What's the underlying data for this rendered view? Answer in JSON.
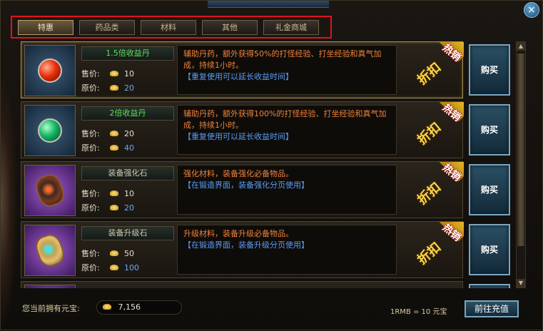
{
  "window": {
    "close_icon": "×"
  },
  "tabs": [
    {
      "label": "特惠",
      "active": true
    },
    {
      "label": "药品类",
      "active": false
    },
    {
      "label": "材料",
      "active": false
    },
    {
      "label": "其他",
      "active": false
    },
    {
      "label": "礼金商城",
      "active": false
    }
  ],
  "items": [
    {
      "name": "1.5倍收益丹",
      "name_color": "green",
      "icon": "red-orb-icon",
      "price_label": "售价:",
      "price": "10",
      "orig_label": "原价:",
      "orig_price": "20",
      "desc": "辅助丹药，额外获得50%的打怪经验、打坐经验和真气加成，持续1小时。",
      "note": "【重复使用可以延长收益时间】",
      "badge_hot": "热销",
      "badge_discount": "折扣",
      "buy_label": "购买"
    },
    {
      "name": "2倍收益丹",
      "name_color": "green",
      "icon": "green-orb-icon",
      "price_label": "售价:",
      "price": "20",
      "orig_label": "原价:",
      "orig_price": "40",
      "desc": "辅助丹药，额外获得100%的打怪经验、打坐经验和真气加成，持续1小时。",
      "note": "【重复使用可以延长收益时间】",
      "badge_hot": "热销",
      "badge_discount": "折扣",
      "buy_label": "购买"
    },
    {
      "name": "装备强化石",
      "name_color": "beige",
      "icon": "enhance-stone-icon",
      "price_label": "售价:",
      "price": "10",
      "orig_label": "原价:",
      "orig_price": "20",
      "desc": "强化材料，装备强化必备物品。",
      "note": "【在锻造界面，装备强化分页使用】",
      "badge_hot": "热销",
      "badge_discount": "折扣",
      "buy_label": "购买"
    },
    {
      "name": "装备升级石",
      "name_color": "beige",
      "icon": "upgrade-stone-icon",
      "price_label": "售价:",
      "price": "50",
      "orig_label": "原价:",
      "orig_price": "100",
      "desc": "升级材料，装备升级必备物品。",
      "note": "【在锻造界面，装备升级分页使用】",
      "badge_hot": "热销",
      "badge_discount": "折扣",
      "buy_label": "购买"
    }
  ],
  "footer": {
    "yuanbao_label": "您当前拥有元宝:",
    "yuanbao_amount": "7,156",
    "rate": "1RMB = 10 元宝",
    "recharge_label": "前往充值"
  }
}
